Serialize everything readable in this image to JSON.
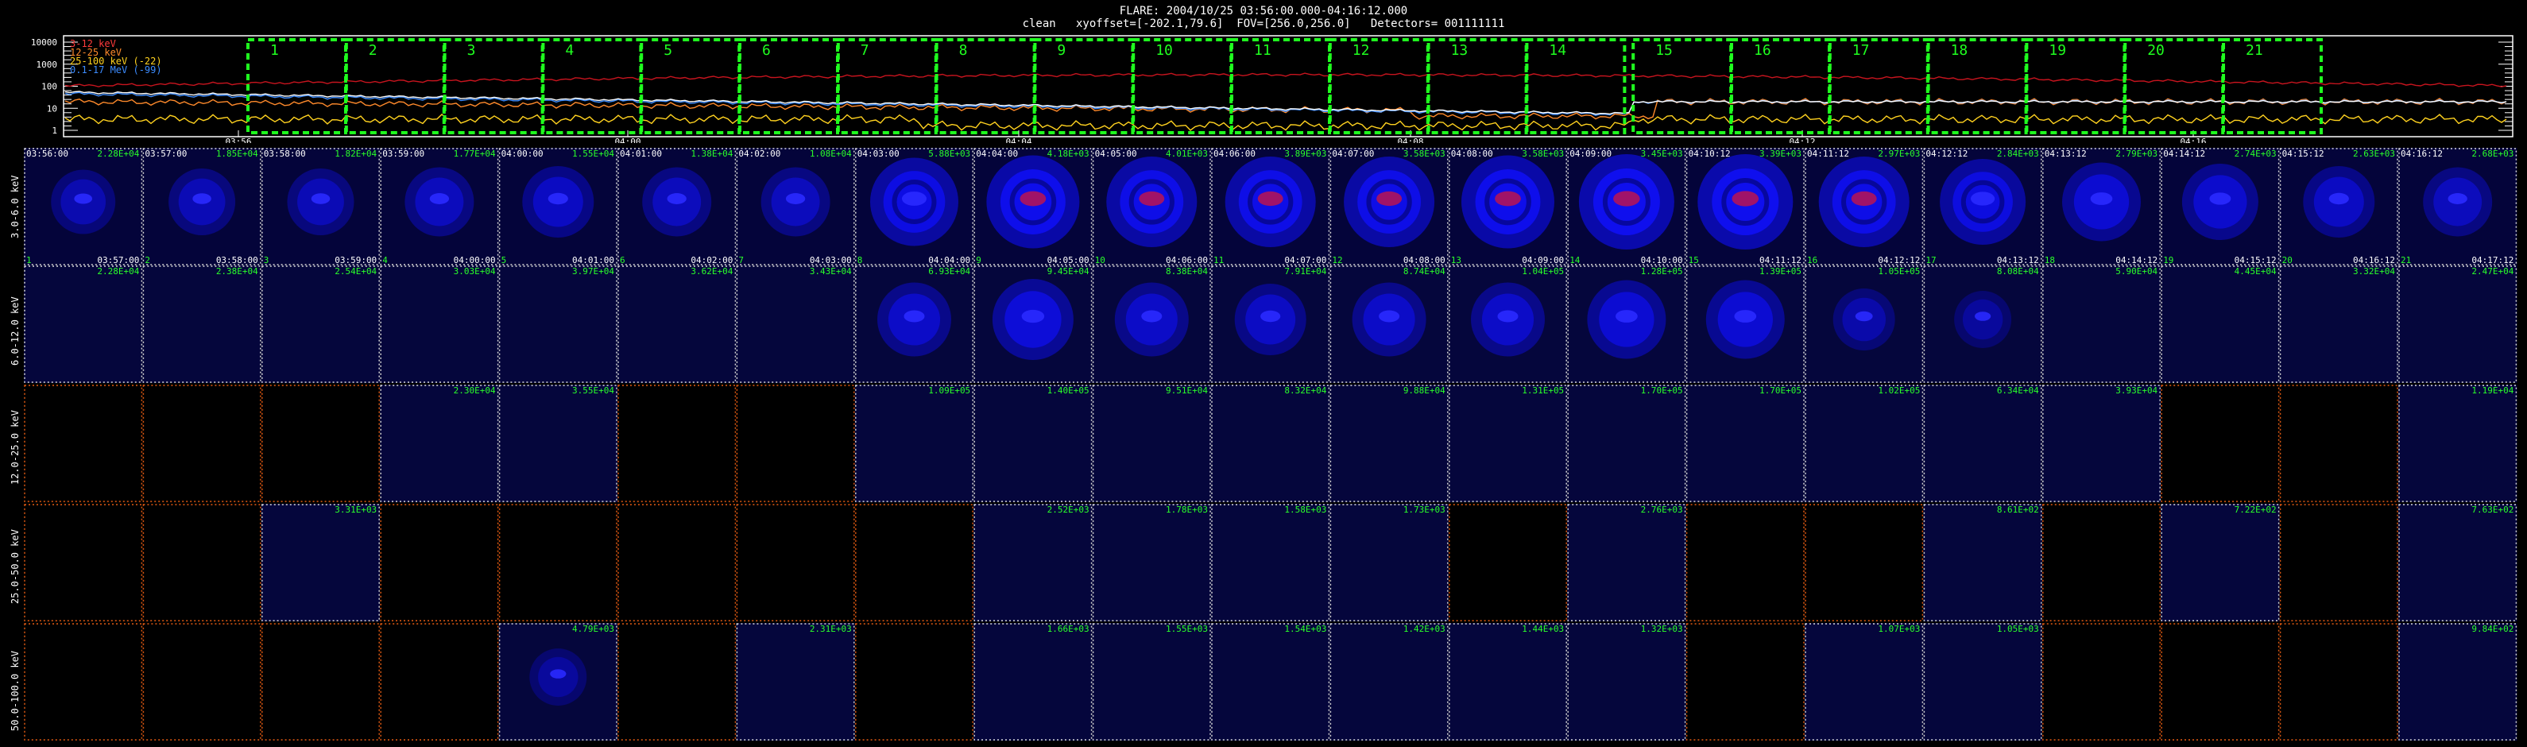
{
  "header": {
    "line1": "FLARE: 2004/10/25 03:56:00.000-04:16:12.000",
    "line2": "clean   xyoffset=[-202.1,79.6]  FOV=[256.0,256.0]   Detectors= 001111111"
  },
  "lightcurve": {
    "y_ticks": [
      "10000",
      "1000",
      "100",
      "10",
      "1"
    ],
    "x_ticks": [
      "03:56",
      "04:00",
      "04:04",
      "04:08",
      "04:12",
      "04:16"
    ],
    "legend": [
      {
        "label": "3-12 keV",
        "color": "#ff3b3b"
      },
      {
        "label": "12-25 keV",
        "color": "#ff3b3b"
      },
      {
        "label": "25-100 keV (-22)",
        "color": "#ffd21f"
      },
      {
        "label": "0.1-17 MeV (-99)",
        "color": "#3c8cff"
      }
    ],
    "interval_labels": [
      "1",
      "2",
      "3",
      "4",
      "5",
      "6",
      "7",
      "8",
      "9",
      "10",
      "11",
      "12",
      "13",
      "14",
      "15",
      "16",
      "17",
      "18",
      "19",
      "20",
      "21"
    ],
    "box_color": "#1fff1f"
  },
  "energy_bands": [
    "3.0-6.0 keV",
    "6.0-12.0 keV",
    "12.0-25.0 keV",
    "25.0-50.0 keV",
    "50.0-100.0 keV"
  ],
  "rows": [
    {
      "start": [
        "03:56:00",
        "03:57:00",
        "03:58:00",
        "03:59:00",
        "04:00:00",
        "04:01:00",
        "04:02:00",
        "04:03:00",
        "04:04:00",
        "04:05:00",
        "04:06:00",
        "04:07:00",
        "04:08:00",
        "04:09:00",
        "04:10:12",
        "04:11:12",
        "04:12:12",
        "04:13:12",
        "04:14:12",
        "04:15:12",
        "04:16:12"
      ],
      "end": [
        "03:57:00",
        "03:58:00",
        "03:59:00",
        "04:00:00",
        "04:01:00",
        "04:02:00",
        "04:03:00",
        "04:04:00",
        "04:05:00",
        "04:06:00",
        "04:07:00",
        "04:08:00",
        "04:09:00",
        "04:10:00",
        "04:11:12",
        "04:12:12",
        "04:13:12",
        "04:14:12",
        "04:15:12",
        "04:16:12",
        "04:17:12"
      ],
      "idx": [
        "1",
        "2",
        "3",
        "4",
        "5",
        "6",
        "7",
        "8",
        "9",
        "10",
        "11",
        "12",
        "13",
        "14",
        "15",
        "16",
        "17",
        "18",
        "19",
        "20",
        "21"
      ],
      "max": [
        "2.28E+04",
        "1.85E+04",
        "1.82E+04",
        "1.77E+04",
        "1.55E+04",
        "1.38E+04",
        "1.08E+04",
        "5.88E+03",
        "4.18E+03",
        "4.01E+03",
        "3.89E+03",
        "3.58E+03",
        "3.58E+03",
        "3.45E+03",
        "3.39E+03",
        "2.97E+03",
        "2.84E+03",
        "2.79E+03",
        "2.74E+03",
        "2.63E+03",
        "2.68E+03"
      ],
      "level": [
        0.35,
        0.4,
        0.4,
        0.45,
        0.5,
        0.45,
        0.45,
        0.85,
        0.95,
        0.9,
        0.9,
        0.9,
        0.95,
        1.0,
        1.0,
        0.9,
        0.8,
        0.65,
        0.6,
        0.5,
        0.45
      ]
    },
    {
      "max": [
        "2.28E+04",
        "2.38E+04",
        "2.54E+04",
        "3.03E+04",
        "3.97E+04",
        "3.62E+04",
        "3.43E+04",
        "6.93E+04",
        "9.45E+04",
        "8.38E+04",
        "7.91E+04",
        "8.74E+04",
        "1.04E+05",
        "1.28E+05",
        "1.39E+05",
        "1.05E+05",
        "8.08E+04",
        "5.90E+04",
        "4.45E+04",
        "3.32E+04",
        "2.47E+04"
      ],
      "level": [
        0.1,
        0.1,
        0.1,
        0.1,
        0.12,
        0.1,
        0.1,
        0.55,
        0.7,
        0.55,
        0.5,
        0.55,
        0.55,
        0.65,
        0.65,
        0.3,
        0.2,
        0.15,
        0.1,
        0.1,
        0.1
      ]
    },
    {
      "max": [
        "",
        "",
        "",
        "2.30E+04",
        "3.55E+04",
        "",
        "",
        "1.09E+05",
        "1.40E+05",
        "9.51E+04",
        "8.32E+04",
        "9.88E+04",
        "1.31E+05",
        "1.70E+05",
        "1.70E+05",
        "1.02E+05",
        "6.34E+04",
        "3.93E+04",
        "",
        "",
        "1.19E+04"
      ],
      "level": [
        0,
        0,
        0,
        0.12,
        0.12,
        0,
        0,
        0.12,
        0.12,
        0.12,
        0.12,
        0.12,
        0.12,
        0.12,
        0.12,
        0.12,
        0.12,
        0.12,
        0,
        0,
        0.12
      ]
    },
    {
      "max": [
        "",
        "",
        "3.31E+03",
        "",
        "",
        "",
        "",
        "",
        "2.52E+03",
        "1.78E+03",
        "1.58E+03",
        "1.73E+03",
        "",
        "2.76E+03",
        "",
        "",
        "8.61E+02",
        "",
        "7.22E+02",
        "",
        "7.63E+02"
      ],
      "level": [
        0,
        0,
        0.12,
        0,
        0,
        0,
        0,
        0,
        0.12,
        0.12,
        0.12,
        0.12,
        0,
        0.12,
        0,
        0,
        0.12,
        0,
        0.12,
        0,
        0.12
      ]
    },
    {
      "max": [
        "",
        "",
        "",
        "",
        "4.79E+03",
        "",
        "2.31E+03",
        "",
        "1.66E+03",
        "1.55E+03",
        "1.54E+03",
        "1.42E+03",
        "1.44E+03",
        "1.32E+03",
        "",
        "1.07E+03",
        "1.05E+03",
        "",
        "",
        "",
        "9.84E+02"
      ],
      "level": [
        0,
        0,
        0,
        0,
        0.2,
        0,
        0.15,
        0,
        0.13,
        0.13,
        0.13,
        0.13,
        0.13,
        0.13,
        0,
        0.13,
        0.13,
        0,
        0,
        0,
        0.13
      ]
    }
  ]
}
